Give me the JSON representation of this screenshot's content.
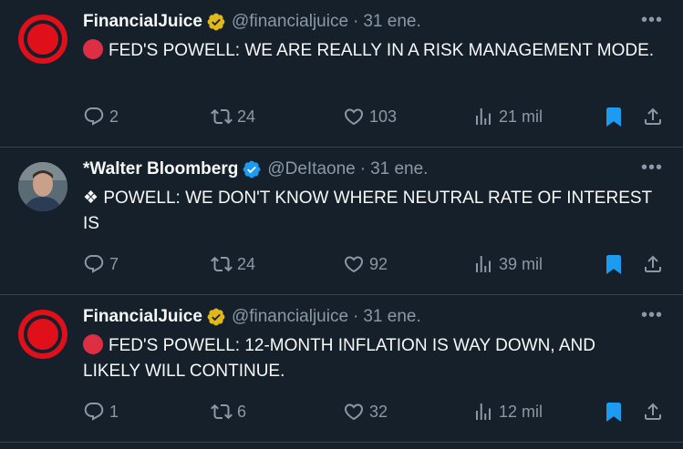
{
  "tweets": [
    {
      "avatar": "financialjuice-logo",
      "name": "FinancialJuice",
      "badge": "gold",
      "handle": "@financialjuice",
      "sep": "·",
      "date": "31 ene.",
      "prefix_icon": "red-circle",
      "text": "FED'S POWELL: WE ARE REALLY IN A RISK MANAGEMENT MODE.",
      "replies": "2",
      "retweets": "24",
      "likes": "103",
      "views": "21 mil"
    },
    {
      "avatar": "photo",
      "name": "*Walter Bloomberg",
      "badge": "blue",
      "handle": "@DeItaone",
      "sep": "·",
      "date": "31 ene.",
      "prefix": "❖",
      "text": "POWELL: WE DON'T KNOW WHERE NEUTRAL RATE OF INTEREST IS",
      "replies": "7",
      "retweets": "24",
      "likes": "92",
      "views": "39 mil"
    },
    {
      "avatar": "financialjuice-logo",
      "name": "FinancialJuice",
      "badge": "gold",
      "handle": "@financialjuice",
      "sep": "·",
      "date": "31 ene.",
      "prefix_icon": "red-circle",
      "text": "FED'S POWELL: 12-MONTH INFLATION IS WAY DOWN, AND LIKELY WILL CONTINUE.",
      "replies": "1",
      "retweets": "6",
      "likes": "32",
      "views": "12 mil"
    }
  ],
  "colors": {
    "background": "#15202b",
    "text": "#f7f9f9",
    "muted": "#8b98a5",
    "divider": "#38444d",
    "accent": "#1d9bf0",
    "gold": "#e2b719",
    "red": "#dd2e44"
  },
  "more_label": "•••"
}
